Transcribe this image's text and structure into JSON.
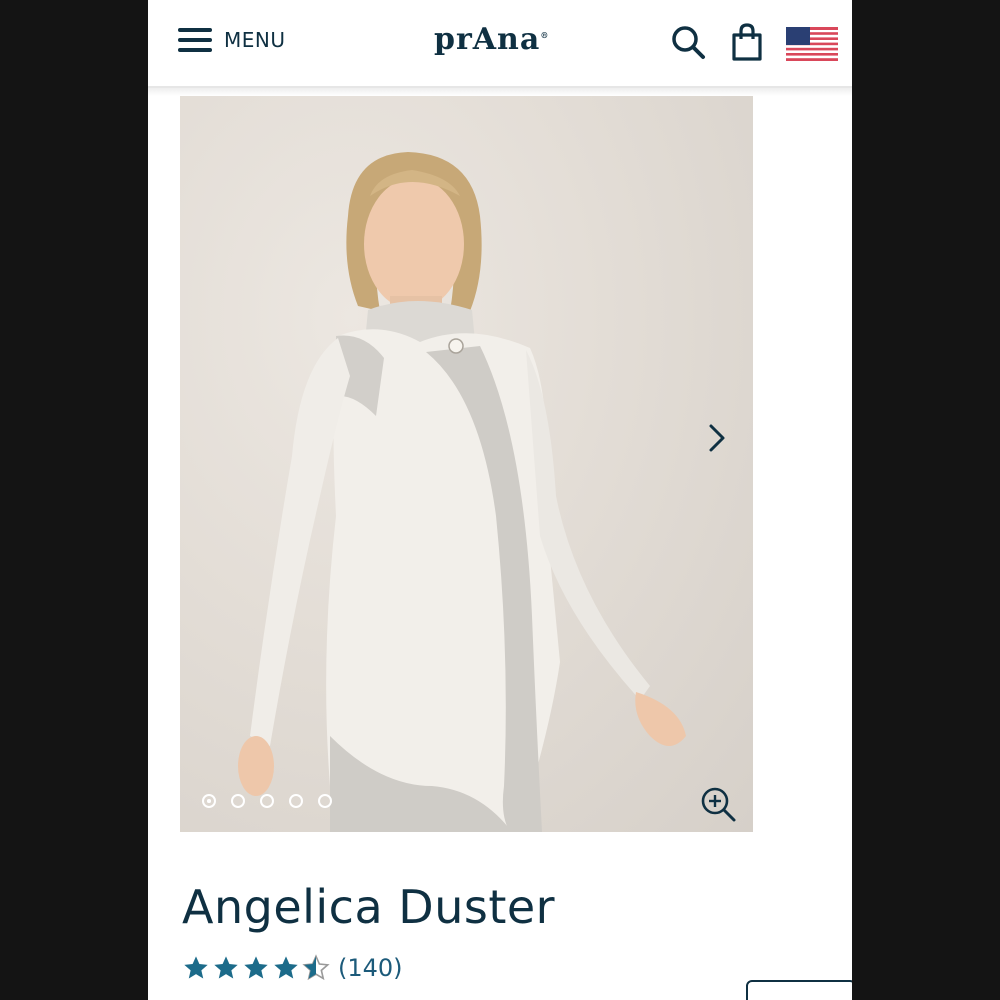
{
  "header": {
    "menu_label": "MENU",
    "logo_text": "prAna",
    "icons": [
      "hamburger-icon",
      "search-icon",
      "shopping-bag-icon",
      "us-flag-icon"
    ]
  },
  "gallery": {
    "image_alt": "Model wearing cream cable-knit long cardigan",
    "slide_count": 5,
    "active_slide": 1,
    "icons": [
      "chevron-right-icon",
      "zoom-in-icon"
    ]
  },
  "product": {
    "name": "Angelica Duster",
    "rating": 4.5,
    "rating_max": 5,
    "review_count": "(140)"
  },
  "colors": {
    "brand": "#0f3042",
    "star": "#1c6b8a",
    "star_empty": "#c7c7c7"
  }
}
